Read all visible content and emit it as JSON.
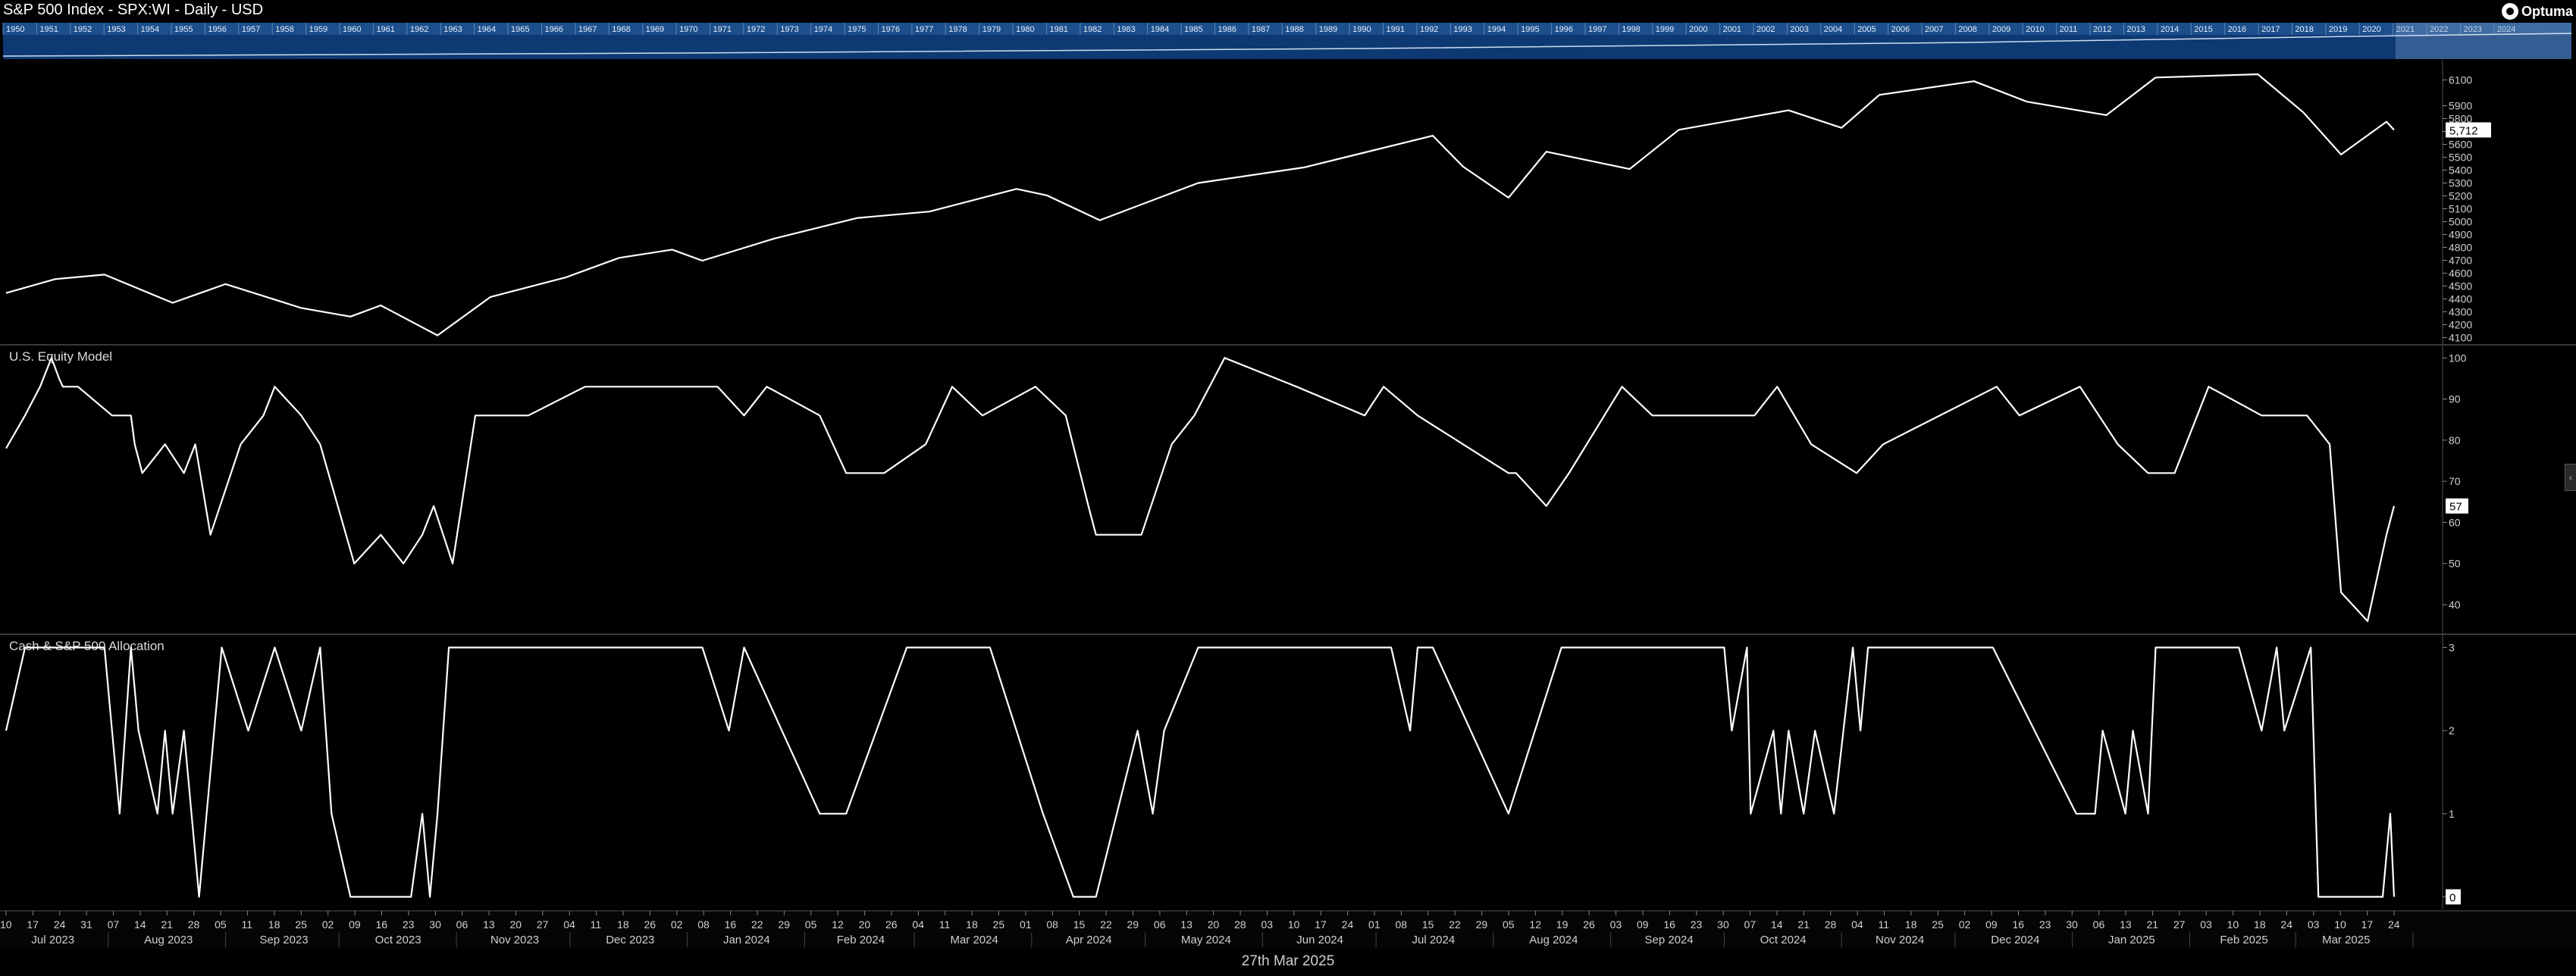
{
  "header": {
    "title": "S&P 500 Index - SPX:WI - Daily - USD",
    "logo_text": "Optuma"
  },
  "footer": {
    "date": "27th Mar 2025"
  },
  "colors": {
    "background": "#000000",
    "line": "#ffffff",
    "navigator": "#0d3a73",
    "grid_sep": "#3a3a3a"
  },
  "navigator_years": [
    "1950",
    "1951",
    "1952",
    "1953",
    "1954",
    "1955",
    "1956",
    "1957",
    "1958",
    "1959",
    "1960",
    "1961",
    "1962",
    "1963",
    "1964",
    "1965",
    "1966",
    "1967",
    "1968",
    "1969",
    "1970",
    "1971",
    "1972",
    "1973",
    "1974",
    "1975",
    "1976",
    "1977",
    "1978",
    "1979",
    "1980",
    "1981",
    "1982",
    "1983",
    "1984",
    "1985",
    "1986",
    "1987",
    "1988",
    "1989",
    "1990",
    "1991",
    "1992",
    "1993",
    "1994",
    "1995",
    "1996",
    "1997",
    "1998",
    "1999",
    "2000",
    "2001",
    "2002",
    "2003",
    "2004",
    "2005",
    "2006",
    "2007",
    "2008",
    "2009",
    "2010",
    "2011",
    "2012",
    "2013",
    "2014",
    "2015",
    "2016",
    "2017",
    "2018",
    "2019",
    "2020",
    "2021",
    "2022",
    "2023",
    "2024"
  ],
  "chart_data": [
    {
      "type": "line",
      "title": "S&P 500 Index - SPX:WI - Daily - USD",
      "ylim": [
        4050,
        6250
      ],
      "yticks": [
        4100,
        4200,
        4300,
        4400,
        4500,
        4600,
        4700,
        4800,
        4900,
        5000,
        5100,
        5200,
        5300,
        5400,
        5500,
        5600,
        5700,
        5800,
        5900,
        6100
      ],
      "last_value_label": "5,712",
      "series": [
        {
          "x": [
            "2023-07-05",
            "2023-07-18",
            "2023-07-31",
            "2023-08-18",
            "2023-09-01",
            "2023-09-21",
            "2023-10-04",
            "2023-10-12",
            "2023-10-27",
            "2023-11-10",
            "2023-11-30",
            "2023-12-14",
            "2023-12-28",
            "2024-01-05",
            "2024-01-24",
            "2024-02-15",
            "2024-03-05",
            "2024-03-28",
            "2024-04-05",
            "2024-04-19",
            "2024-05-15",
            "2024-06-12",
            "2024-07-16",
            "2024-07-24",
            "2024-08-05",
            "2024-08-15",
            "2024-09-06",
            "2024-09-19",
            "2024-10-18",
            "2024-11-01",
            "2024-11-11",
            "2024-12-06",
            "2024-12-20",
            "2025-01-10",
            "2025-01-23",
            "2025-02-19",
            "2025-03-03",
            "2025-03-13",
            "2025-03-25",
            "2025-03-27"
          ],
          "y": [
            4446,
            4554,
            4589,
            4370,
            4515,
            4330,
            4263,
            4350,
            4117,
            4415,
            4568,
            4719,
            4783,
            4697,
            4869,
            5029,
            5078,
            5254,
            5204,
            5011,
            5300,
            5421,
            5667,
            5427,
            5186,
            5543,
            5408,
            5713,
            5864,
            5728,
            5984,
            6090,
            5931,
            5827,
            6119,
            6144,
            5849,
            5521,
            5776,
            5712
          ]
        }
      ]
    },
    {
      "type": "line",
      "title": "U.S. Equity Model",
      "ylim": [
        33,
        103
      ],
      "yticks": [
        40,
        50,
        60,
        70,
        80,
        90,
        100
      ],
      "last_value_label": "57",
      "series": [
        {
          "x": [
            "2023-07-05",
            "2023-07-10",
            "2023-07-14",
            "2023-07-17",
            "2023-07-19",
            "2023-07-20",
            "2023-07-24",
            "2023-08-02",
            "2023-08-07",
            "2023-08-08",
            "2023-08-10",
            "2023-08-16",
            "2023-08-21",
            "2023-08-24",
            "2023-08-28",
            "2023-09-05",
            "2023-09-11",
            "2023-09-14",
            "2023-09-21",
            "2023-09-26",
            "2023-10-05",
            "2023-10-12",
            "2023-10-18",
            "2023-10-23",
            "2023-10-26",
            "2023-10-31",
            "2023-11-06",
            "2023-11-20",
            "2023-12-05",
            "2024-01-09",
            "2024-01-16",
            "2024-01-22",
            "2024-02-05",
            "2024-02-12",
            "2024-02-22",
            "2024-03-04",
            "2024-03-11",
            "2024-03-19",
            "2024-04-02",
            "2024-04-10",
            "2024-04-16",
            "2024-04-18",
            "2024-04-30",
            "2024-05-08",
            "2024-05-14",
            "2024-05-22",
            "2024-06-10",
            "2024-06-28",
            "2024-07-03",
            "2024-07-12",
            "2024-07-24",
            "2024-08-05",
            "2024-08-07",
            "2024-08-15",
            "2024-08-21",
            "2024-09-04",
            "2024-09-12",
            "2024-09-26",
            "2024-10-09",
            "2024-10-15",
            "2024-10-24",
            "2024-11-05",
            "2024-11-12",
            "2024-12-12",
            "2024-12-18",
            "2025-01-03",
            "2025-01-13",
            "2025-01-21",
            "2025-01-28",
            "2025-02-06",
            "2025-02-20",
            "2025-03-04",
            "2025-03-10",
            "2025-03-13",
            "2025-03-20",
            "2025-03-25",
            "2025-03-27"
          ],
          "y": [
            78,
            86,
            93,
            100,
            95,
            93,
            93,
            86,
            86,
            79,
            72,
            79,
            72,
            79,
            57,
            79,
            86,
            93,
            86,
            79,
            50,
            57,
            50,
            57,
            64,
            50,
            86,
            86,
            93,
            93,
            86,
            93,
            86,
            72,
            72,
            79,
            93,
            86,
            93,
            86,
            64,
            57,
            57,
            79,
            86,
            100,
            93,
            86,
            93,
            86,
            79,
            72,
            72,
            64,
            72,
            93,
            86,
            86,
            86,
            93,
            79,
            72,
            79,
            93,
            86,
            93,
            79,
            72,
            72,
            93,
            86,
            86,
            79,
            43,
            36,
            57,
            64
          ]
        }
      ]
    },
    {
      "type": "line",
      "title": "Cash & S&P 500 Allocation",
      "ylim": [
        -0.15,
        3.15
      ],
      "yticks": [
        0,
        1,
        2,
        3
      ],
      "last_value_label": "0",
      "series": [
        {
          "x": [
            "2023-07-05",
            "2023-07-10",
            "2023-07-17",
            "2023-07-31",
            "2023-08-02",
            "2023-08-04",
            "2023-08-07",
            "2023-08-09",
            "2023-08-14",
            "2023-08-16",
            "2023-08-18",
            "2023-08-21",
            "2023-08-25",
            "2023-08-31",
            "2023-09-07",
            "2023-09-14",
            "2023-09-21",
            "2023-09-26",
            "2023-09-29",
            "2023-10-04",
            "2023-10-12",
            "2023-10-20",
            "2023-10-23",
            "2023-10-25",
            "2023-10-27",
            "2023-10-30",
            "2023-11-03",
            "2023-11-17",
            "2024-01-05",
            "2024-01-12",
            "2024-01-16",
            "2024-02-05",
            "2024-02-12",
            "2024-02-28",
            "2024-03-06",
            "2024-03-21",
            "2024-04-04",
            "2024-04-12",
            "2024-04-18",
            "2024-04-29",
            "2024-05-03",
            "2024-05-06",
            "2024-05-15",
            "2024-06-05",
            "2024-07-05",
            "2024-07-10",
            "2024-07-12",
            "2024-07-16",
            "2024-08-05",
            "2024-08-19",
            "2024-10-01",
            "2024-10-03",
            "2024-10-07",
            "2024-10-08",
            "2024-10-14",
            "2024-10-16",
            "2024-10-18",
            "2024-10-22",
            "2024-10-25",
            "2024-10-30",
            "2024-11-04",
            "2024-11-06",
            "2024-11-08",
            "2024-12-11",
            "2025-01-02",
            "2025-01-07",
            "2025-01-09",
            "2025-01-15",
            "2025-01-17",
            "2025-01-21",
            "2025-01-23",
            "2025-02-14",
            "2025-02-20",
            "2025-02-24",
            "2025-02-26",
            "2025-03-05",
            "2025-03-07",
            "2025-03-24",
            "2025-03-26",
            "2025-03-27"
          ],
          "y": [
            2,
            3,
            3,
            3,
            2,
            1,
            3,
            2,
            1,
            2,
            1,
            2,
            0,
            3,
            2,
            3,
            2,
            3,
            1,
            0,
            0,
            0,
            1,
            0,
            1,
            3,
            3,
            3,
            3,
            2,
            3,
            1,
            1,
            3,
            3,
            3,
            1,
            0,
            0,
            2,
            1,
            2,
            3,
            3,
            3,
            2,
            3,
            3,
            1,
            3,
            3,
            2,
            3,
            1,
            2,
            1,
            2,
            1,
            2,
            1,
            3,
            2,
            3,
            3,
            1,
            1,
            2,
            1,
            2,
            1,
            3,
            3,
            2,
            3,
            2,
            3,
            0,
            0,
            1,
            0
          ]
        }
      ]
    }
  ],
  "x_axis": {
    "day_ticks": [
      "10",
      "17",
      "24",
      "31",
      "07",
      "14",
      "21",
      "28",
      "05",
      "11",
      "18",
      "25",
      "02",
      "09",
      "16",
      "23",
      "30",
      "06",
      "13",
      "20",
      "27",
      "04",
      "11",
      "18",
      "26",
      "02",
      "08",
      "16",
      "22",
      "29",
      "05",
      "12",
      "20",
      "26",
      "04",
      "11",
      "18",
      "25",
      "01",
      "08",
      "15",
      "22",
      "29",
      "06",
      "13",
      "20",
      "28",
      "03",
      "10",
      "17",
      "24",
      "01",
      "08",
      "15",
      "22",
      "29",
      "05",
      "12",
      "19",
      "26",
      "03",
      "09",
      "16",
      "23",
      "30",
      "07",
      "14",
      "21",
      "28",
      "04",
      "11",
      "18",
      "25",
      "02",
      "09",
      "16",
      "23",
      "30",
      "06",
      "13",
      "21",
      "27",
      "03",
      "10",
      "18",
      "24",
      "03",
      "10",
      "17",
      "24"
    ],
    "month_labels": [
      "Jul 2023",
      "Aug 2023",
      "Sep 2023",
      "Oct 2023",
      "Nov 2023",
      "Dec 2023",
      "Jan 2024",
      "Feb 2024",
      "Mar 2024",
      "Apr 2024",
      "May 2024",
      "Jun 2024",
      "Jul 2024",
      "Aug 2024",
      "Sep 2024",
      "Oct 2024",
      "Nov 2024",
      "Dec 2024",
      "Jan 2025",
      "Feb 2025",
      "Mar 2025"
    ]
  }
}
